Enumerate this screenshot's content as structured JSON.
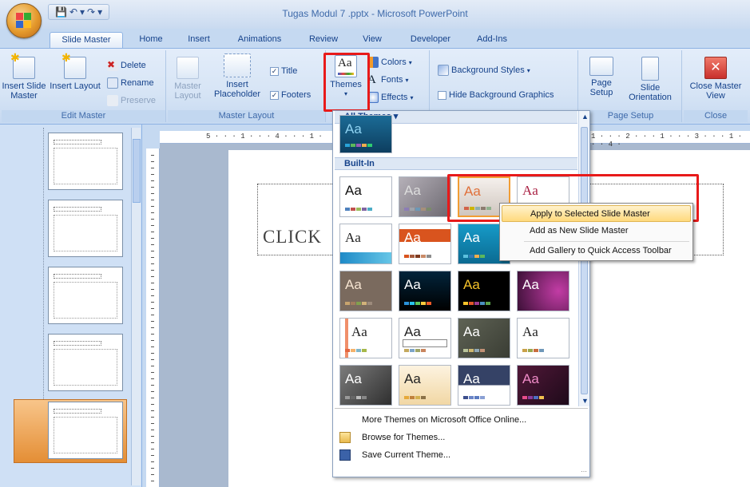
{
  "window": {
    "title": "Tugas Modul 7 .pptx - Microsoft PowerPoint"
  },
  "tabs": [
    "Slide Master",
    "Home",
    "Insert",
    "Animations",
    "Review",
    "View",
    "Developer",
    "Add-Ins"
  ],
  "ribbon": {
    "edit_master": {
      "label": "Edit Master",
      "insert_slide_master": "Insert Slide Master",
      "insert_layout": "Insert Layout",
      "delete": "Delete",
      "rename": "Rename",
      "preserve": "Preserve"
    },
    "master_layout": {
      "label": "Master Layout",
      "master_layout_btn": "Master Layout",
      "insert_placeholder": "Insert Placeholder",
      "title_chk": "Title",
      "footers_chk": "Footers"
    },
    "edit_theme": {
      "themes": "Themes",
      "colors": "Colors",
      "fonts": "Fonts",
      "effects": "Effects"
    },
    "background": {
      "styles": "Background Styles",
      "hide_graphics": "Hide Background Graphics"
    },
    "page_setup": {
      "label": "Page Setup",
      "page_setup_btn": "Page Setup",
      "orientation": "Slide Orientation"
    },
    "close": {
      "label": "Close",
      "close_btn": "Close Master View"
    }
  },
  "gallery": {
    "all_themes": "All Themes",
    "built_in": "Built-In",
    "more_online": "More Themes on Microsoft Office Online...",
    "browse": "Browse for Themes...",
    "save": "Save Current Theme...",
    "aa": "Aa"
  },
  "context_menu": {
    "apply_selected": "Apply to Selected Slide Master",
    "add_new": "Add as New Slide Master",
    "add_gallery": "Add Gallery to Quick Access Toolbar"
  },
  "slide": {
    "title_placeholder": "CLICK"
  },
  "ruler": {
    "h_left": "5 · · · 1 · · · 4 · · · 1 ·",
    "h_right": "1 · · · 2 · · · 1 · · · 3 · · · 1 · · · 4 ·"
  },
  "colors": {
    "highlight": "#e81a1a",
    "accent_orange": "#f19d34"
  }
}
